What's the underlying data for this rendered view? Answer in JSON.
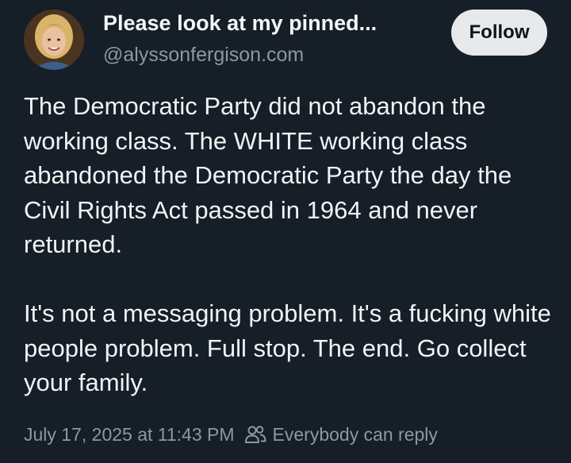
{
  "author": {
    "display_name": "Please look at my pinned...",
    "handle": "@alyssonfergison.com",
    "avatar_icon": "profile-photo"
  },
  "follow_button": {
    "label": "Follow"
  },
  "post": {
    "paragraphs": [
      "The Democratic Party did not abandon the working class.  The WHITE working class abandoned the Democratic Party the day the Civil Rights Act passed in 1964 and never returned.",
      "It's not a messaging problem.  It's a fucking white people problem.  Full stop. The end.  Go collect your family."
    ]
  },
  "meta": {
    "timestamp": "July 17, 2025 at 11:43 PM",
    "reply_setting": "Everybody can reply",
    "reply_icon": "people-icon"
  },
  "colors": {
    "background": "#161e27",
    "text": "#f1f3f5",
    "muted": "#8b98a5",
    "button_bg": "#e7e9ea"
  }
}
